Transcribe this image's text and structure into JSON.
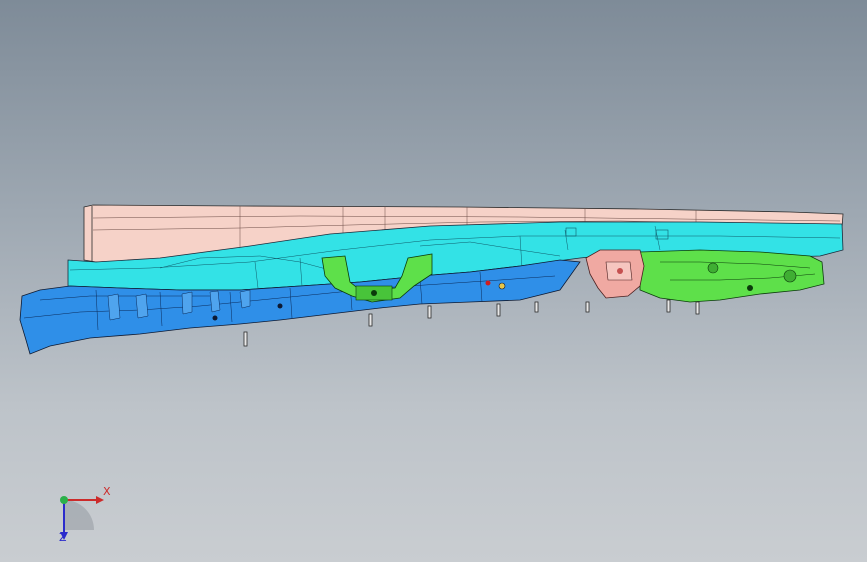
{
  "viewport": {
    "background_top": "#7e8b98",
    "background_bottom": "#c9cdd1"
  },
  "model": {
    "part_colors": {
      "rail_upper_salmon": "#f5cfc4",
      "rail_cyan": "#2fe0e6",
      "floor_blue": "#2f8fe8",
      "bracket_green": "#5ee04a",
      "mount_pink": "#f0a9a2",
      "edge": "#1b2a3a"
    }
  },
  "triad": {
    "x_label": "X",
    "z_label": "Z",
    "x_color": "#cc2b2b",
    "y_color": "#2bb04a",
    "z_color": "#2b2bcc"
  }
}
